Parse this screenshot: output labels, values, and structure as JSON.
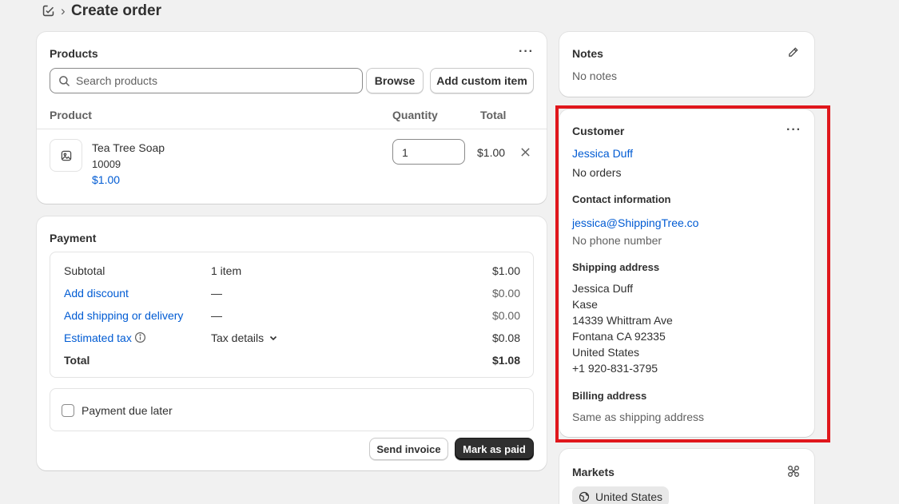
{
  "header": {
    "title": "Create order",
    "chevron": "›"
  },
  "products": {
    "title": "Products",
    "search_placeholder": "Search products",
    "browse_label": "Browse",
    "add_custom_label": "Add custom item",
    "columns": {
      "product": "Product",
      "quantity": "Quantity",
      "total": "Total"
    },
    "items": [
      {
        "name": "Tea Tree Soap",
        "sku": "10009",
        "price": "$1.00",
        "quantity": "1",
        "total": "$1.00"
      }
    ]
  },
  "payment": {
    "title": "Payment",
    "rows": [
      {
        "label": "Subtotal",
        "middle": "1 item",
        "amount": "$1.00"
      },
      {
        "label": "Add discount",
        "middle": "—",
        "amount": "$0.00"
      },
      {
        "label": "Add shipping or delivery",
        "middle": "—",
        "amount": "$0.00"
      },
      {
        "label": "Estimated tax",
        "middle": "Tax details",
        "amount": "$0.08"
      },
      {
        "label": "Total",
        "middle": "",
        "amount": "$1.08"
      }
    ],
    "due_later_label": "Payment due later",
    "send_invoice_label": "Send invoice",
    "mark_paid_label": "Mark as paid"
  },
  "notes": {
    "title": "Notes",
    "text": "No notes"
  },
  "customer": {
    "title": "Customer",
    "name": "Jessica Duff",
    "orders": "No orders",
    "contact_title": "Contact information",
    "email": "jessica@ShippingTree.co",
    "phone": "No phone number",
    "shipping_title": "Shipping address",
    "shipping_lines": [
      "Jessica Duff",
      "Kase",
      "14339 Whittram Ave",
      "Fontana CA 92335",
      "United States",
      "+1 920-831-3795"
    ],
    "billing_title": "Billing address",
    "billing_text": "Same as shipping address"
  },
  "markets": {
    "title": "Markets",
    "badge": "United States"
  },
  "colors": {
    "link": "#005bd3",
    "highlight": "#e0171c",
    "primary_button": "#303030"
  }
}
